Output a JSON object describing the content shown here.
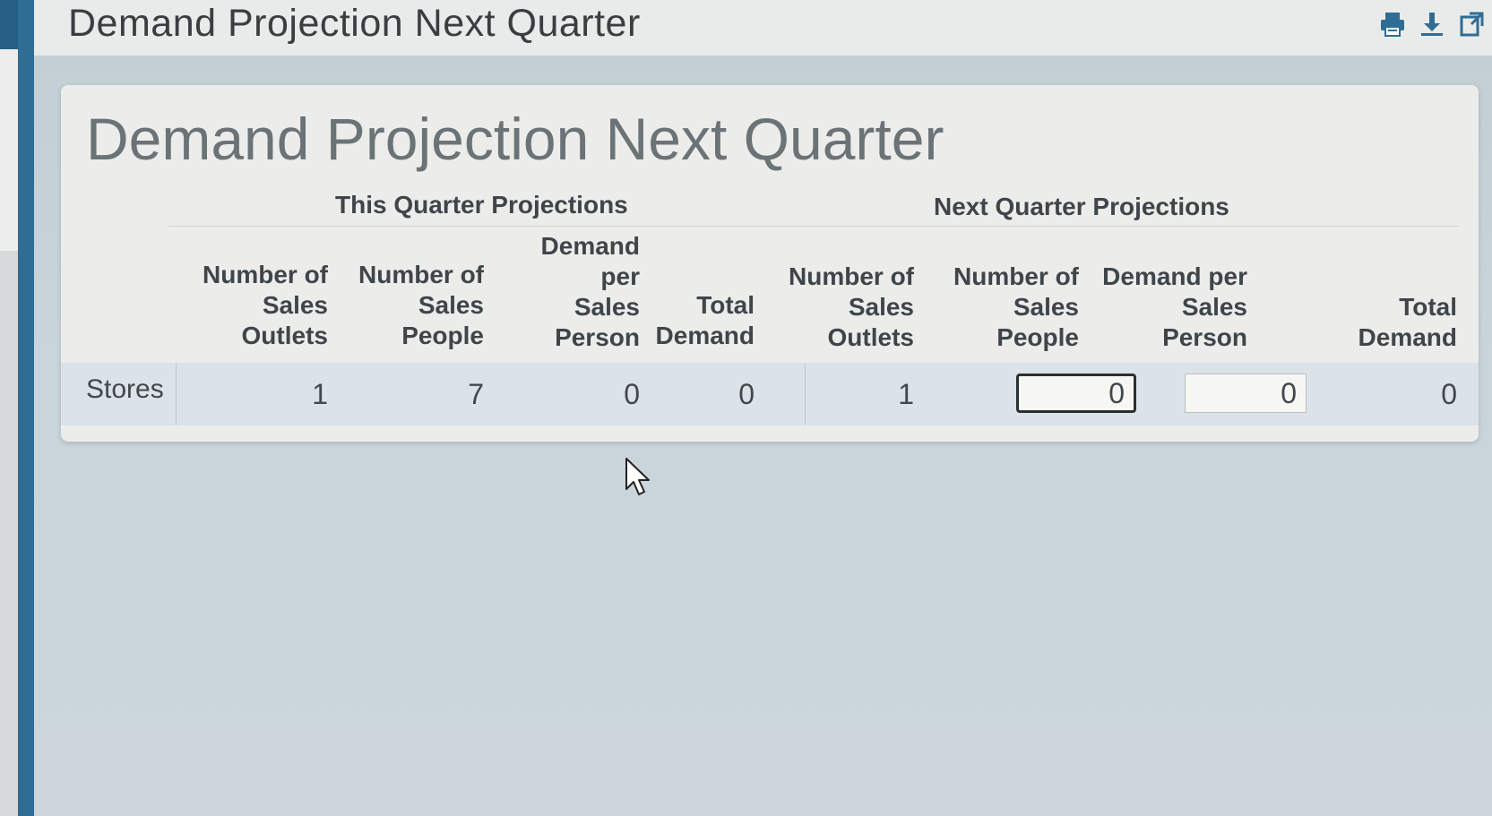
{
  "header": {
    "title": "Demand Projection Next Quarter",
    "icons": [
      "print-icon",
      "download-icon",
      "export-icon"
    ]
  },
  "panel": {
    "title": "Demand Projection Next Quarter",
    "groups": {
      "this_quarter": "This Quarter Projections",
      "next_quarter": "Next Quarter Projections"
    },
    "columns": {
      "tq_outlets": [
        "Number of",
        "Sales",
        "Outlets"
      ],
      "tq_people": [
        "Number of",
        "Sales",
        "People"
      ],
      "tq_demand_per": [
        "Demand",
        "per",
        "Sales",
        "Person"
      ],
      "tq_total": [
        "Total",
        "Demand"
      ],
      "nq_outlets": [
        "Number of",
        "Sales",
        "Outlets"
      ],
      "nq_people": [
        "Number of",
        "Sales",
        "People"
      ],
      "nq_demand_per": [
        "Demand per",
        "Sales",
        "Person"
      ],
      "nq_total": [
        "Total",
        "Demand"
      ]
    },
    "rows": [
      {
        "label": "Stores",
        "tq_outlets": "1",
        "tq_people": "7",
        "tq_demand_per": "0",
        "tq_total": "0",
        "nq_outlets": "1",
        "nq_people": "0",
        "nq_demand_per": "0",
        "nq_total": "0"
      }
    ]
  },
  "colors": {
    "brand_bar": "#2f6d94",
    "panel_bg": "#ecedeb",
    "row_bg": "#dbe2e8"
  }
}
